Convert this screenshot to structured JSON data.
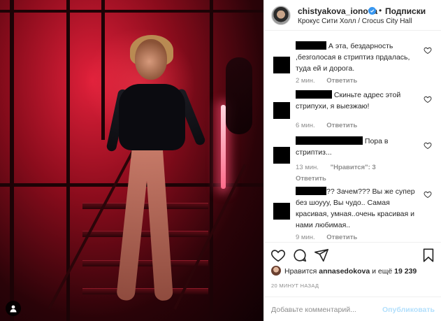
{
  "post": {
    "username": "chistyakova_ionova",
    "separator": "•",
    "follow_label": "Подписки",
    "location": "Крокус Сити Холл / Crocus City Hall"
  },
  "comments": [
    {
      "text_before": "",
      "text": "А эта, бездарность ,безголосая в стриптиз прдалась, туда ей и дорога.",
      "time": "2 мин.",
      "reply_label": "Ответить",
      "likes_label": ""
    },
    {
      "text": "Скиньте адрес этой стрипухи, я выезжаю!",
      "time": "6 мин.",
      "reply_label": "Ответить",
      "likes_label": ""
    },
    {
      "text": "Пора в стриптиз...",
      "time": "13 мин.",
      "reply_label": "",
      "likes_label": "\"Нравится\": 3",
      "reply_label_2": "Ответить"
    },
    {
      "text": "Зачем??? Вы же супер без шоууу, Вы чудо.. Самая красивая, умная..очень красивая и нами любимая..",
      "redacted_prefix": "??",
      "time": "9 мин.",
      "reply_label": "Ответить",
      "likes_label": ""
    }
  ],
  "likes": {
    "prefix": "Нравится ",
    "user": "annasedokova",
    "middle": " и ещё ",
    "count": "19 239"
  },
  "timestamp": "20 МИНУТ НАЗАД",
  "add_comment": {
    "placeholder": "Добавьте комментарий...",
    "publish_label": "Опубликовать"
  },
  "colors": {
    "accent_blue": "#3897f0",
    "publish_disabled": "#b2dffc",
    "meta_gray": "#8e8e8e",
    "photo_red": "#c0152c"
  },
  "icons": [
    "verified-badge-icon",
    "heart-icon",
    "comment-icon",
    "share-icon",
    "bookmark-icon",
    "user-tag-icon"
  ]
}
